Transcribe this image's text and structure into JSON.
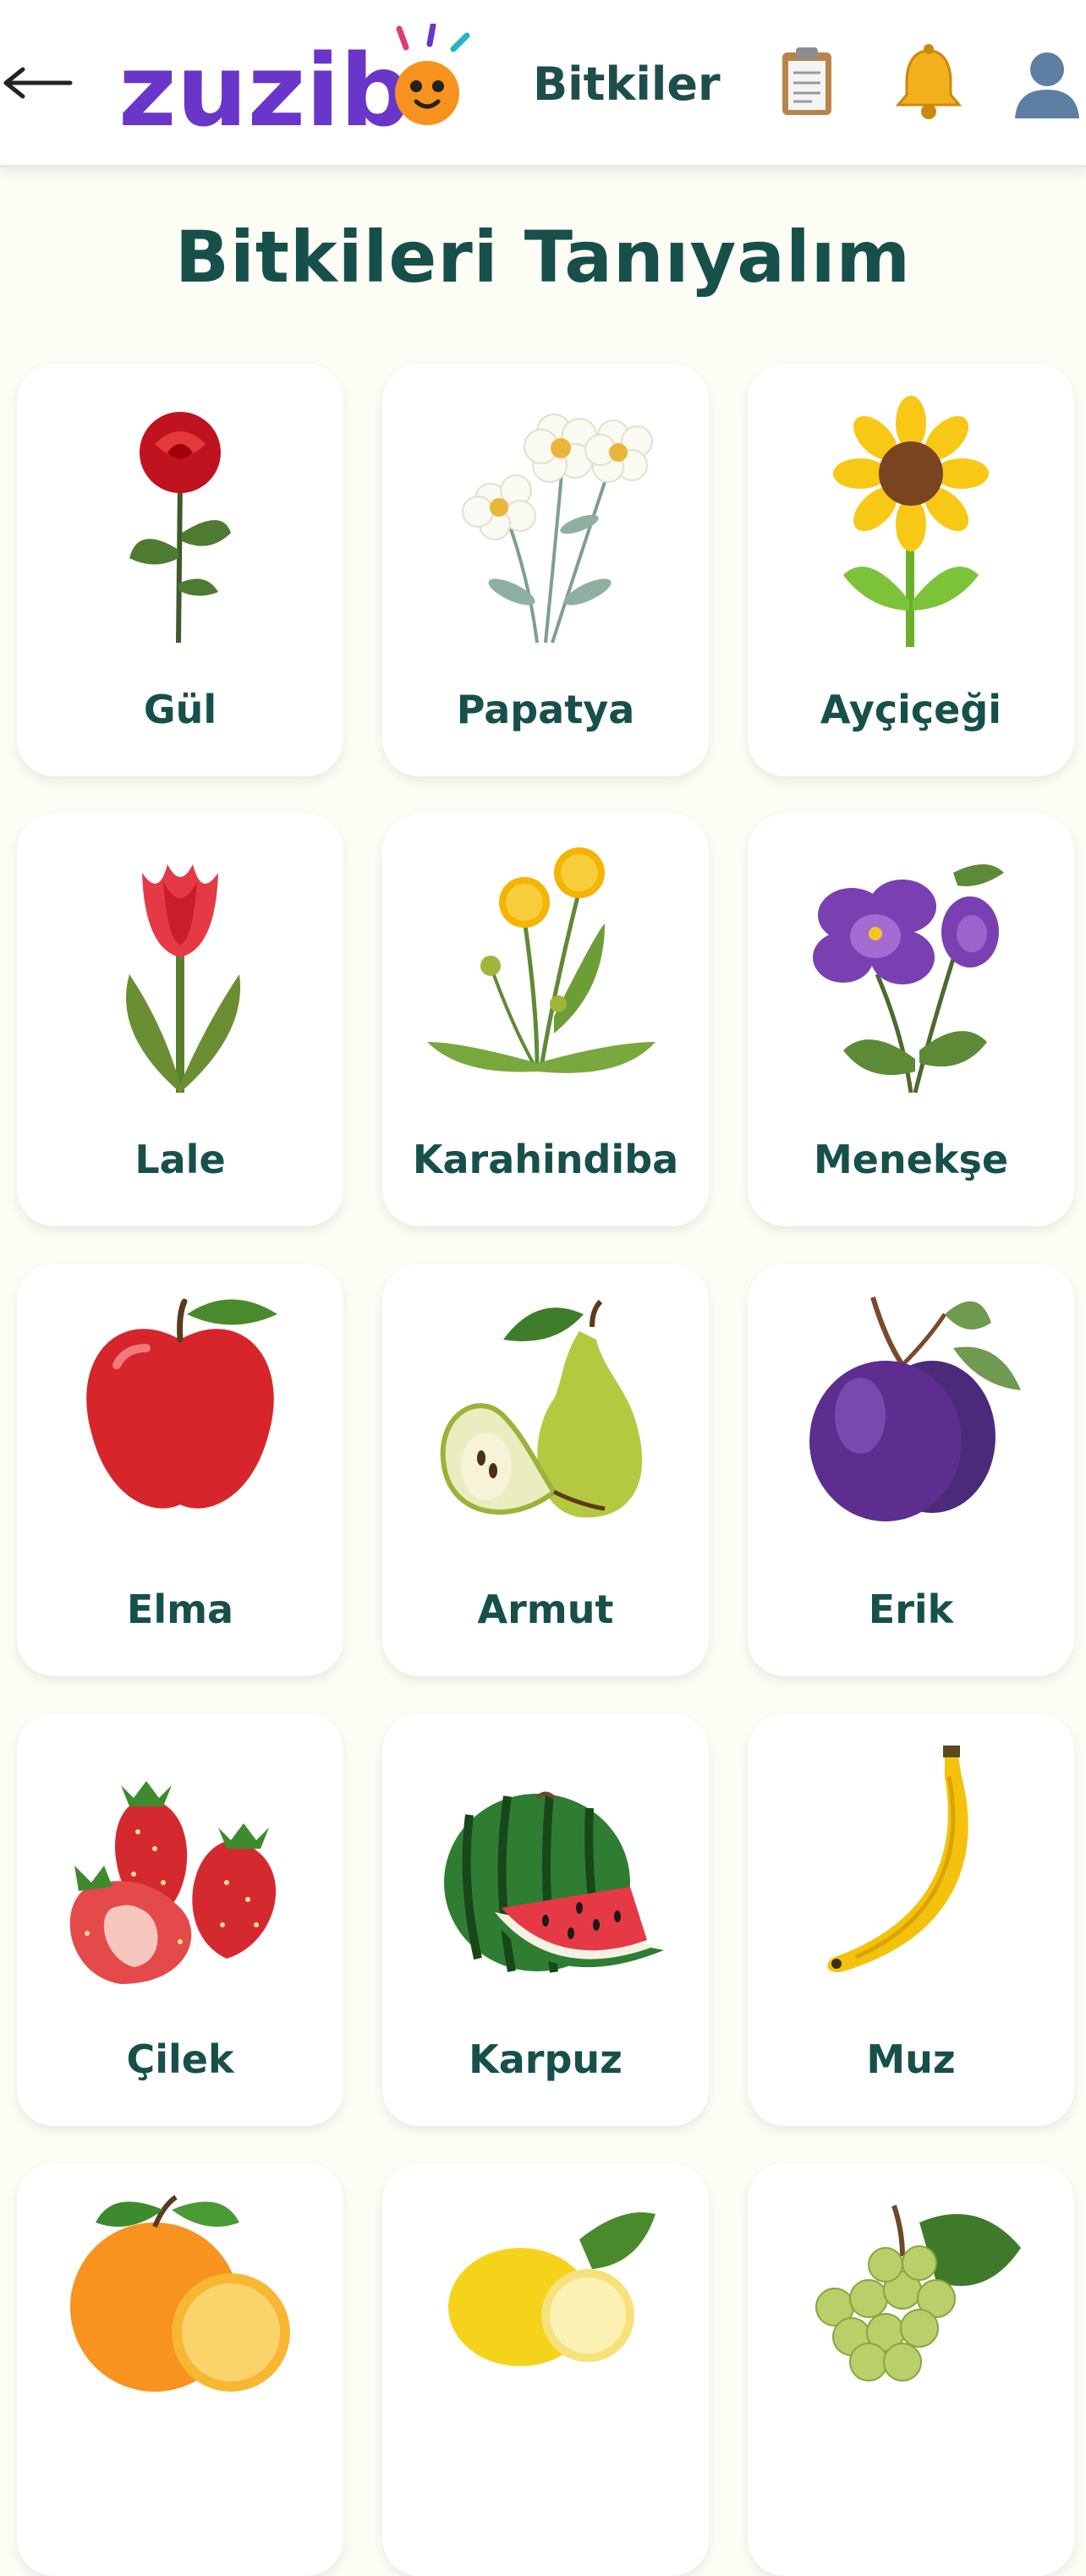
{
  "header": {
    "back_icon": "back-arrow-icon",
    "logo_text": "zuzibo",
    "title": "Bitkiler",
    "icons": [
      "clipboard-icon",
      "bell-icon",
      "profile-icon"
    ]
  },
  "page": {
    "title": "Bitkileri Tanıyalım"
  },
  "plants": [
    {
      "label": "Gül",
      "icon": "rose-icon"
    },
    {
      "label": "Papatya",
      "icon": "daisy-icon"
    },
    {
      "label": "Ayçiçeği",
      "icon": "sunflower-icon"
    },
    {
      "label": "Lale",
      "icon": "tulip-icon"
    },
    {
      "label": "Karahindiba",
      "icon": "dandelion-icon"
    },
    {
      "label": "Menekşe",
      "icon": "violet-icon"
    },
    {
      "label": "Elma",
      "icon": "apple-icon"
    },
    {
      "label": "Armut",
      "icon": "pear-icon"
    },
    {
      "label": "Erik",
      "icon": "plum-icon"
    },
    {
      "label": "Çilek",
      "icon": "strawberry-icon"
    },
    {
      "label": "Karpuz",
      "icon": "watermelon-icon"
    },
    {
      "label": "Muz",
      "icon": "banana-icon"
    },
    {
      "label": "",
      "icon": "orange-icon"
    },
    {
      "label": "",
      "icon": "lemon-icon"
    },
    {
      "label": "",
      "icon": "grape-icon"
    }
  ],
  "colors": {
    "accent_text": "#17504b",
    "logo_purple": "#6a35c9",
    "logo_orange": "#f7921e",
    "background": "#fdfcf5"
  }
}
